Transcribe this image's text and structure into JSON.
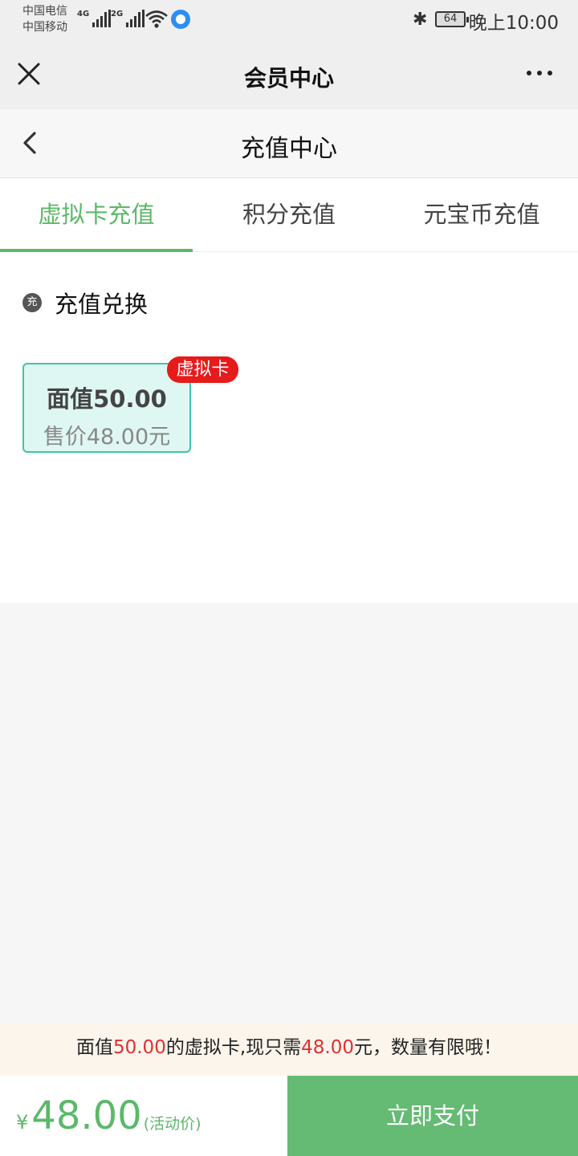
{
  "status_bar": {
    "carrier1": "中国电信",
    "carrier2": "中国移动",
    "net1": "4G",
    "net2": "2G",
    "battery": "64",
    "time": "晚上10:00"
  },
  "nav1": {
    "title": "会员中心",
    "icons": [
      "close-icon",
      "more-icon"
    ]
  },
  "nav2": {
    "title": "充值中心",
    "icons": [
      "back-icon"
    ]
  },
  "tabs": [
    {
      "label": "虚拟卡充值",
      "active": true
    },
    {
      "label": "积分充值",
      "active": false
    },
    {
      "label": "元宝币充值",
      "active": false
    }
  ],
  "section": {
    "icon_text": "充",
    "label": "充值兑换"
  },
  "card": {
    "face_value": "面值50.00",
    "sale_price": "售价48.00元",
    "badge": "虚拟卡"
  },
  "promo": {
    "prefix": "面值",
    "face_value": "50.00",
    "middle": "的虚拟卡,现只需",
    "price": "48.00",
    "suffix": "元，数量有限哦！"
  },
  "footer": {
    "currency": "¥",
    "amount": "48.00",
    "tag": "(活动价)",
    "pay_label": "立即支付"
  },
  "colors": {
    "accent_green": "#5cb86a",
    "card_border": "#3fc5a6",
    "badge_red": "#e61b1b",
    "promo_red": "#e03030"
  }
}
